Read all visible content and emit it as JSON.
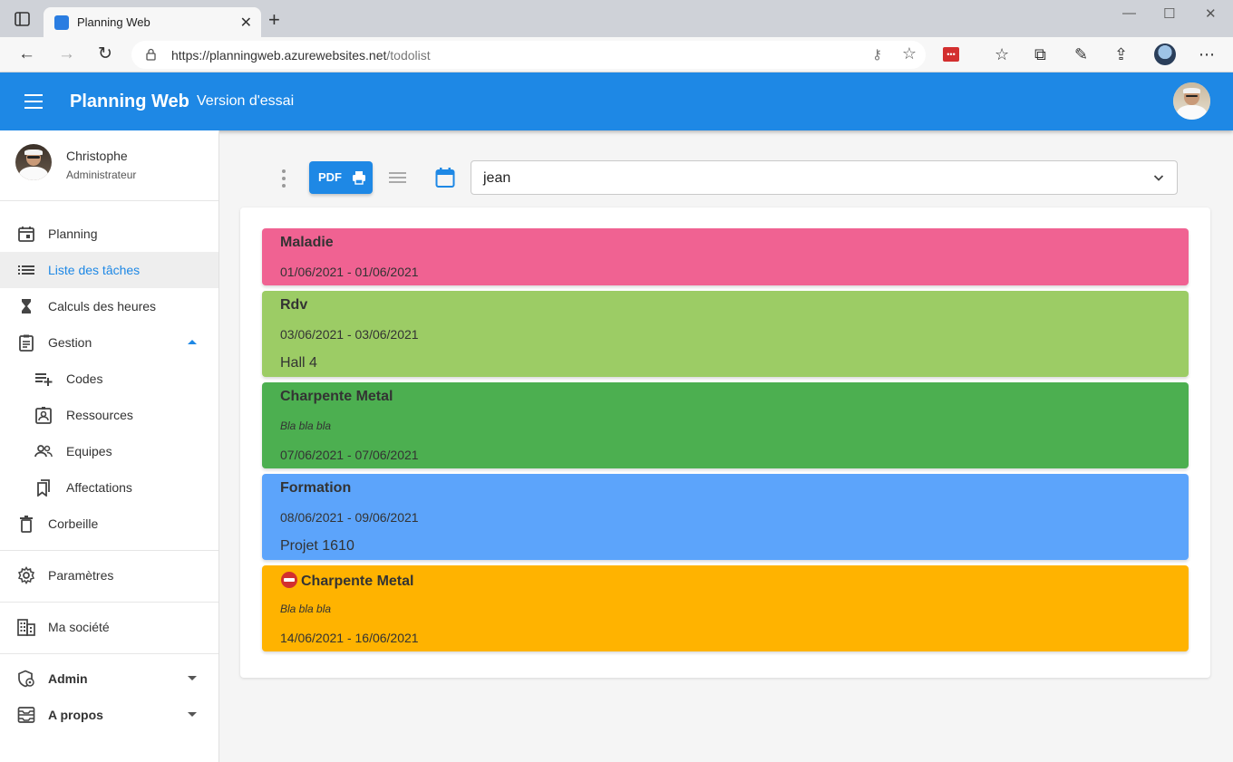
{
  "browser": {
    "tab_title": "Planning Web",
    "url_host": "https://planningweb.azurewebsites.net",
    "url_path": "/todolist",
    "ext_label": "•••"
  },
  "header": {
    "brand": "Planning Web",
    "version": "Version d'essai"
  },
  "user": {
    "name": "Christophe",
    "role": "Administrateur"
  },
  "sidebar": {
    "planning": "Planning",
    "tasks": "Liste des tâches",
    "hours": "Calculs des heures",
    "gestion": "Gestion",
    "codes": "Codes",
    "resources": "Ressources",
    "teams": "Equipes",
    "assignments": "Affectations",
    "trash": "Corbeille",
    "settings": "Paramètres",
    "company": "Ma société",
    "admin": "Admin",
    "about": "A propos"
  },
  "toolbar": {
    "pdf_label": "PDF",
    "selected_resource": "jean"
  },
  "tasks": [
    {
      "title": "Maladie",
      "desc": "",
      "dates": "01/06/2021 - 01/06/2021",
      "note": "",
      "color": "#f06292"
    },
    {
      "title": "Rdv",
      "desc": "",
      "dates": "03/06/2021 - 03/06/2021",
      "note": "Hall 4",
      "color": "#9ccc65"
    },
    {
      "title": "Charpente Metal",
      "desc": "Bla bla bla",
      "dates": "07/06/2021 - 07/06/2021",
      "note": "",
      "color": "#4caf50"
    },
    {
      "title": "Formation",
      "desc": "",
      "dates": "08/06/2021 - 09/06/2021",
      "note": "Projet 1610",
      "color": "#5ca4fb"
    },
    {
      "title": "Charpente Metal",
      "desc": "Bla bla bla",
      "dates": "14/06/2021 - 16/06/2021",
      "note": "",
      "color": "#ffb300"
    }
  ]
}
